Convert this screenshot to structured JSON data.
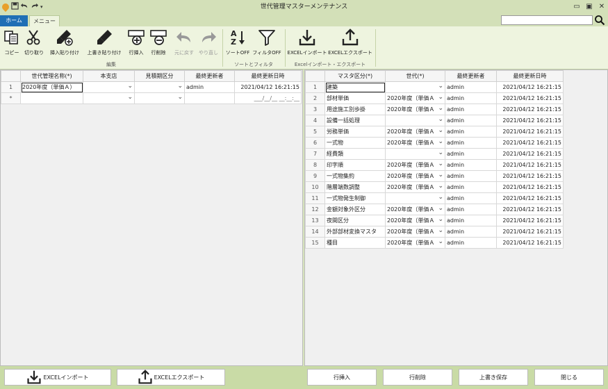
{
  "window": {
    "title": "世代管理マスターメンテナンス",
    "minimize": "▭",
    "maximize": "▣",
    "close": "✕"
  },
  "tabs": {
    "home": "ホーム",
    "menu": "メニュー"
  },
  "search": {
    "placeholder": "",
    "icon": "search-icon"
  },
  "ribbon": {
    "copy": "コピー",
    "cut": "切り取り",
    "insert_paste": "挿入貼り付け",
    "overwrite_paste": "上書き貼り付け",
    "row_insert": "行挿入",
    "row_delete": "行削除",
    "undo": "元に戻す",
    "redo": "やり直し",
    "sort_off": "ソートOFF",
    "filter_off": "フィルタOFF",
    "excel_import": "EXCELインポート",
    "excel_export": "EXCELエクスポート",
    "group_edit": "編集",
    "group_sort_filter": "ソートとフィルタ",
    "group_excel": "Excelインポート・エクスポート"
  },
  "left_grid": {
    "headers": [
      "世代管理名称(*)",
      "本支店",
      "見積期区分",
      "最終更新者",
      "最終更新日時"
    ],
    "rows": [
      {
        "num": "1",
        "name": "2020年度（単価Ａ）",
        "branch": "",
        "period": "",
        "user": "admin",
        "date": "2021/04/12 16:21:15"
      }
    ],
    "new_row": {
      "num": "*",
      "date_mask": "___/__/__ __:__:__"
    }
  },
  "right_grid": {
    "headers": [
      "マスタ区分(*)",
      "世代(*)",
      "最終更新者",
      "最終更新日時"
    ],
    "rows": [
      {
        "num": "1",
        "category": "建築",
        "gen": "",
        "user": "admin",
        "date": "2021/04/12 16:21:15"
      },
      {
        "num": "2",
        "category": "部材単価",
        "gen": "2020年度（単価Ａ",
        "user": "admin",
        "date": "2021/04/12 16:21:15"
      },
      {
        "num": "3",
        "category": "用途施工別歩掛",
        "gen": "2020年度（単価Ａ",
        "user": "admin",
        "date": "2021/04/12 16:21:15"
      },
      {
        "num": "4",
        "category": "設備一括処理",
        "gen": "",
        "user": "admin",
        "date": "2021/04/12 16:21:15"
      },
      {
        "num": "5",
        "category": "労務単価",
        "gen": "2020年度（単価Ａ",
        "user": "admin",
        "date": "2021/04/12 16:21:15"
      },
      {
        "num": "6",
        "category": "一式物",
        "gen": "2020年度（単価Ａ",
        "user": "admin",
        "date": "2021/04/12 16:21:15"
      },
      {
        "num": "7",
        "category": "経費類",
        "gen": "",
        "user": "admin",
        "date": "2021/04/12 16:21:15"
      },
      {
        "num": "8",
        "category": "印字順",
        "gen": "2020年度（単価Ａ",
        "user": "admin",
        "date": "2021/04/12 16:21:15"
      },
      {
        "num": "9",
        "category": "一式物集約",
        "gen": "2020年度（単価Ａ",
        "user": "admin",
        "date": "2021/04/12 16:21:15"
      },
      {
        "num": "10",
        "category": "階層端数調整",
        "gen": "2020年度（単価Ａ",
        "user": "admin",
        "date": "2021/04/12 16:21:15"
      },
      {
        "num": "11",
        "category": "一式物発生制御",
        "gen": "",
        "user": "admin",
        "date": "2021/04/12 16:21:15"
      },
      {
        "num": "12",
        "category": "金額対象外区分",
        "gen": "2020年度（単価Ａ",
        "user": "admin",
        "date": "2021/04/12 16:21:15"
      },
      {
        "num": "13",
        "category": "夜間区分",
        "gen": "2020年度（単価Ａ",
        "user": "admin",
        "date": "2021/04/12 16:21:15"
      },
      {
        "num": "14",
        "category": "外部部材変換マスタ",
        "gen": "2020年度（単価Ａ",
        "user": "admin",
        "date": "2021/04/12 16:21:15"
      },
      {
        "num": "15",
        "category": "種目",
        "gen": "2020年度（単価Ａ",
        "user": "admin",
        "date": "2021/04/12 16:21:15"
      }
    ]
  },
  "bottom": {
    "excel_import": "EXCELインポート",
    "excel_export": "EXCELエクスポート",
    "row_insert": "行挿入",
    "row_delete": "行削除",
    "save": "上書き保存",
    "close": "閉じる"
  },
  "colors": {
    "accent": "#1f6fb5",
    "ribbon_bg": "#eef4df",
    "frame_bg": "#d3e0b8",
    "bottom_bg": "#c9dba6"
  }
}
